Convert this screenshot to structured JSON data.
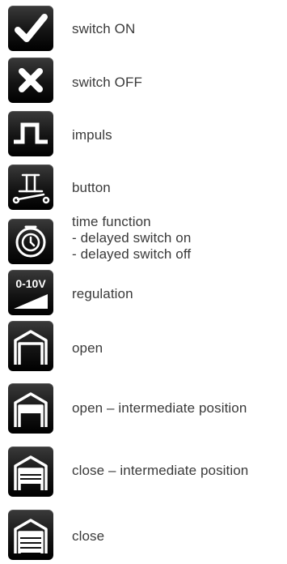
{
  "items": [
    {
      "icon": "checkmark-icon",
      "lines": [
        "switch ON"
      ]
    },
    {
      "icon": "cross-icon",
      "lines": [
        "switch OFF"
      ]
    },
    {
      "icon": "pulse-icon",
      "lines": [
        "impuls"
      ]
    },
    {
      "icon": "push-button-icon",
      "lines": [
        "button"
      ]
    },
    {
      "icon": "timer-icon",
      "lines": [
        "time function",
        "- delayed switch on",
        "- delayed switch off"
      ]
    },
    {
      "icon": "regulation-icon",
      "icon_text": "0-10V",
      "lines": [
        "regulation"
      ]
    },
    {
      "icon": "garage-open-icon",
      "lines": [
        "open"
      ]
    },
    {
      "icon": "garage-open-intermediate-icon",
      "lines": [
        "open – intermediate position"
      ]
    },
    {
      "icon": "garage-close-intermediate-icon",
      "lines": [
        "close – intermediate position"
      ]
    },
    {
      "icon": "garage-closed-icon",
      "lines": [
        "close"
      ]
    }
  ]
}
